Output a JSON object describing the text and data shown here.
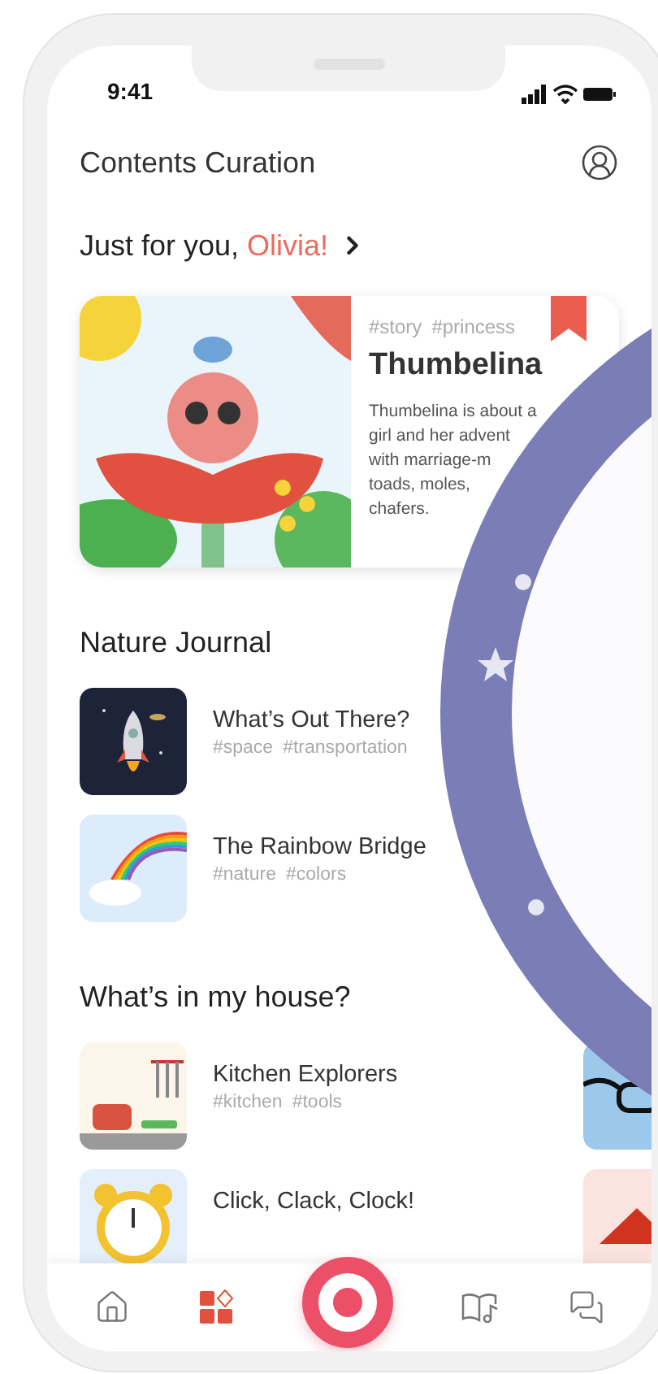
{
  "status_bar": {
    "time": "9:41"
  },
  "header": {
    "title": "Contents Curation"
  },
  "greeting": {
    "text": "Just for you, ",
    "name": "Olivia!"
  },
  "featured": {
    "tags": [
      "#story",
      "#princess"
    ],
    "title": "Thumbelina",
    "description": "Thumbelina is about a\ngirl and her advent\nwith marriage-m\ntoads, moles,\nchafers.",
    "bookmarked": true
  },
  "sections": [
    {
      "title": "Nature Journal",
      "items": [
        {
          "kind": "rocket",
          "title": "What’s Out There?",
          "tags": [
            "#space",
            "#transportation"
          ]
        },
        {
          "kind": "rainbow",
          "title": "The Rainbow Bridge",
          "tags": [
            "#nature",
            "#colors"
          ]
        }
      ]
    },
    {
      "title": "What’s in my house?",
      "items": [
        {
          "kind": "kitchen",
          "title": "Kitchen Explorers",
          "tags": [
            "#kitchen",
            "#tools"
          ]
        },
        {
          "kind": "clock",
          "title": "Click, Clack, Clock!"
        }
      ],
      "peek": [
        {
          "kind": "glasses"
        },
        {
          "kind": "triangle"
        }
      ]
    }
  ],
  "nav": [
    {
      "kind": "home",
      "selected": false
    },
    {
      "kind": "grid",
      "selected": true
    },
    {
      "kind": "record",
      "selected": false
    },
    {
      "kind": "book",
      "selected": false
    },
    {
      "kind": "chat",
      "selected": false
    }
  ]
}
